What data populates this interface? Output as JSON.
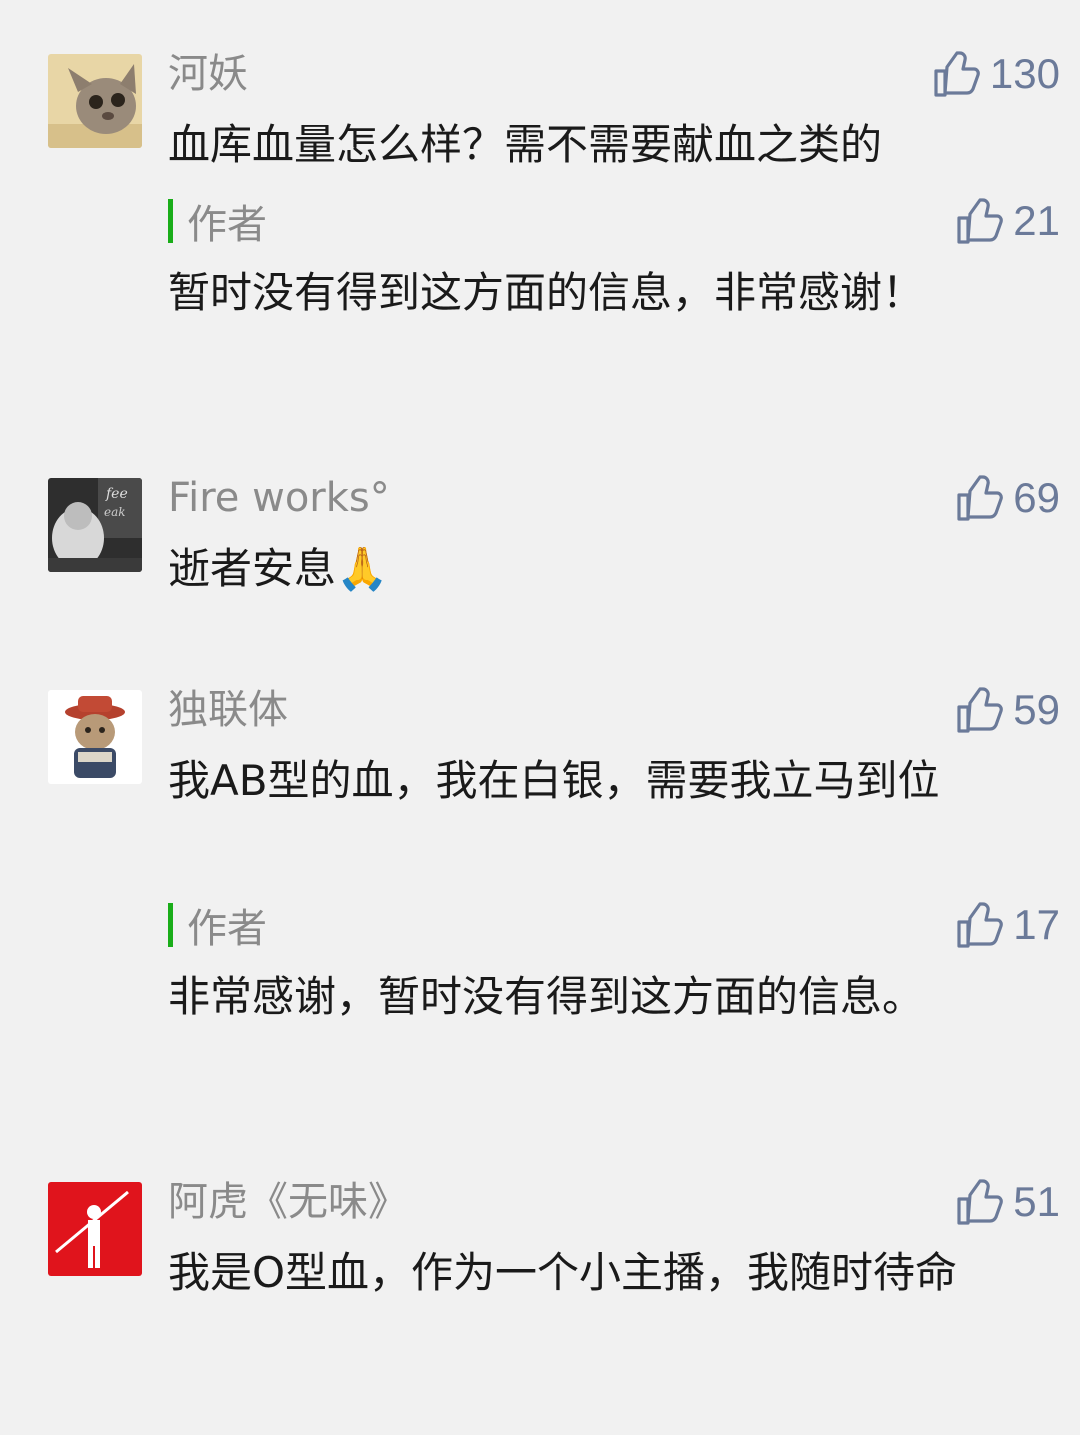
{
  "comments": [
    {
      "name": "河妖",
      "likes": "130",
      "text": "血库血量怎么样？需不需要献血之类的",
      "reply": {
        "tag": "作者",
        "likes": "21",
        "text": "暂时没有得到这方面的信息，非常感谢！"
      }
    },
    {
      "name": "Fire works°",
      "likes": "69",
      "text": "逝者安息🙏"
    },
    {
      "name": "独联体",
      "likes": "59",
      "text": "我AB型的血，我在白银，需要我立马到位",
      "reply": {
        "tag": "作者",
        "likes": "17",
        "text": "非常感谢，暂时没有得到这方面的信息。"
      }
    },
    {
      "name": "阿虎《无味》",
      "likes": "51",
      "text": "我是O型血，作为一个小主播，我随时待命"
    }
  ],
  "colors": {
    "background": "#f1f1f1",
    "like_blue": "#6b7a99",
    "author_bar_green": "#1aad19",
    "name_gray": "#8a8a8a"
  },
  "icons": {
    "like": "thumbs-up-icon",
    "avatar": "user-avatar"
  }
}
